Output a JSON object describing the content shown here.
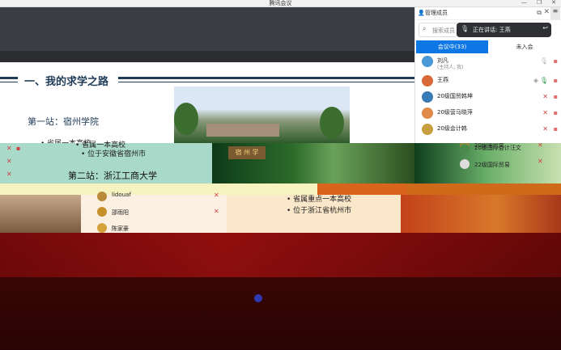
{
  "window": {
    "title": "腾讯会议",
    "buttons": [
      "—",
      "❐",
      "✕"
    ]
  },
  "slide": {
    "heading": "一、我的求学之路",
    "station1": "第一站：宿州学院",
    "bullet_partial": "• 省属一本高校",
    "station1_bullets": [
      "• 省属一本高校",
      "• 位于安徽省宿州市"
    ],
    "station2": "第二站：浙江工商大学",
    "station2_bullets": [
      "• 省属重点一本高校",
      "• 位于浙江省杭州市"
    ],
    "photo_sign": "宿 州 学"
  },
  "panel": {
    "title": "管理成员",
    "search_placeholder": "搜索成员",
    "speaking": "正在讲话: 王燕",
    "tabs": [
      "会议中(33)",
      "未入会"
    ],
    "participants": [
      {
        "name": "刘凡",
        "sub": "(主持人, 我)",
        "color": "#4a9ad8"
      },
      {
        "name": "王燕",
        "sub": "",
        "color": "#d86a3a"
      },
      {
        "name": "20级国贸韩坤",
        "sub": "",
        "color": "#3a7ab8"
      },
      {
        "name": "20级营马晓萍",
        "sub": "",
        "color": "#e08a4a"
      }
    ],
    "bleed_names": [
      "20级会计韩",
      "20级国贸奕",
      "20级国际会计汪文",
      "22级国际贸易"
    ],
    "left_names": [
      "lidouaf",
      "邵雨阳",
      "陈家豪"
    ]
  },
  "icons": {
    "mic": "microphone-icon",
    "video": "camera-icon",
    "search": "search-icon",
    "close": "close-icon"
  }
}
